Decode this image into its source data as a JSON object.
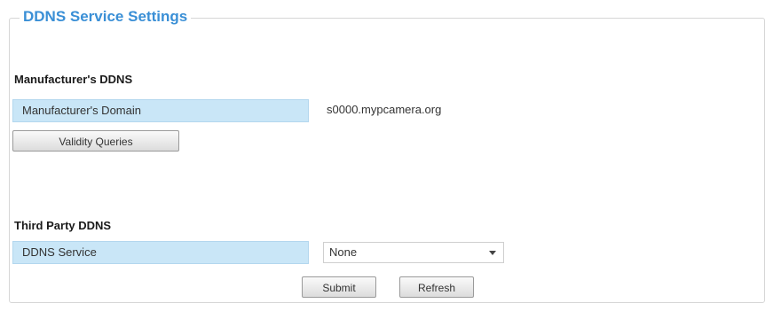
{
  "panel": {
    "legend": "DDNS Service Settings"
  },
  "manufacturer": {
    "title": "Manufacturer's DDNS",
    "domain_label": "Manufacturer's Domain",
    "domain_value": "s0000.mypcamera.org",
    "validity_button": "Validity Queries"
  },
  "third_party": {
    "title": "Third Party DDNS",
    "service_label": "DDNS Service",
    "service_selected": "None"
  },
  "actions": {
    "submit": "Submit",
    "refresh": "Refresh"
  }
}
